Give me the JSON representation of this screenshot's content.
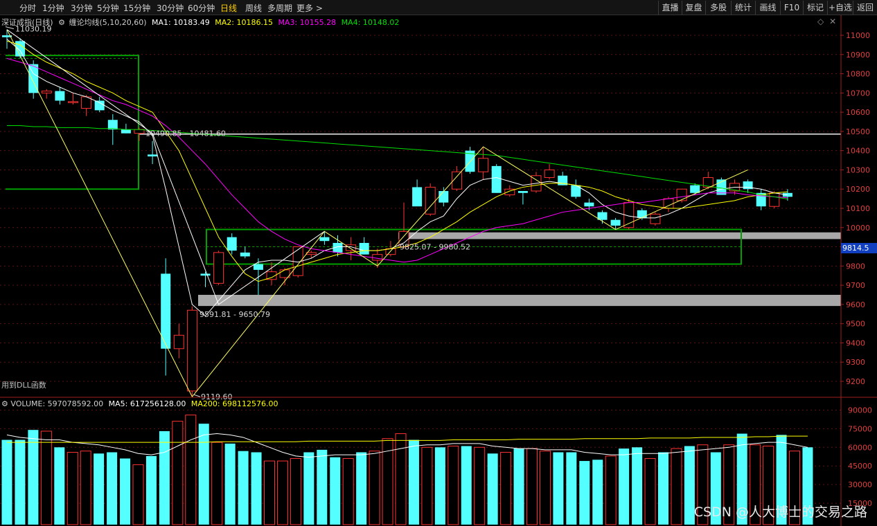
{
  "toolbar": {
    "periods": [
      "分时",
      "1分钟",
      "3分钟",
      "5分钟",
      "15分钟",
      "30分钟",
      "60分钟",
      "日线",
      "周线",
      "多周期",
      "更多 >"
    ],
    "active_period": "日线",
    "right_buttons": [
      "直播",
      "复盘",
      "多股",
      "统计",
      "画线",
      "F10",
      "标记",
      "+自选",
      "返回"
    ]
  },
  "main_panel": {
    "title": "深证成指(日线)",
    "indicator": "缠论均线(5,10,20,60)",
    "ma1": "MA1: 10183.49",
    "ma2": "MA2: 10186.15",
    "ma3": "MA3: 10155.28",
    "ma4": "MA4: 10148.02",
    "price_tag": "9814.5",
    "dll_note": "用到DLL函数",
    "annotations": {
      "high": "11030.19",
      "low": "9119.60",
      "zone1": "10490.85 - 10481.60",
      "zone2": "9825.07 - 9980.52",
      "zone3": "9591.81 - 9650.79"
    }
  },
  "volume_panel": {
    "volume": "VOLUME: 597078592.00",
    "ma5": "MA5: 617256128.00",
    "ma200": "MA200: 698112576.00"
  },
  "watermark": "CSDN @人大博士的交易之路",
  "colors": {
    "up": "#ff3232",
    "down": "#54ffff",
    "ma1": "#ffffff",
    "ma2": "#ffff00",
    "ma3": "#ff00ff",
    "ma4": "#00e000",
    "box": "#00a000",
    "zone": "#a0a0a0"
  },
  "chart_data": [
    {
      "type": "candlestick",
      "title": "深证成指(日线)",
      "y_ticks": [
        11000,
        10900,
        10800,
        10700,
        10600,
        10500,
        10400,
        10300,
        10200,
        10100,
        10000,
        9900,
        9800,
        9700,
        9600,
        9500,
        9400,
        9300,
        9200
      ],
      "ylim": [
        9060,
        11100
      ],
      "candles": [
        {
          "o": 11000,
          "h": 11030,
          "l": 10930,
          "c": 10990
        },
        {
          "o": 10970,
          "h": 10985,
          "l": 10880,
          "c": 10890
        },
        {
          "o": 10850,
          "h": 10870,
          "l": 10670,
          "c": 10700
        },
        {
          "o": 10700,
          "h": 10720,
          "l": 10670,
          "c": 10710
        },
        {
          "o": 10710,
          "h": 10730,
          "l": 10640,
          "c": 10660
        },
        {
          "o": 10650,
          "h": 10700,
          "l": 10640,
          "c": 10655
        },
        {
          "o": 10620,
          "h": 10690,
          "l": 10580,
          "c": 10680
        },
        {
          "o": 10660,
          "h": 10680,
          "l": 10600,
          "c": 10610
        },
        {
          "o": 10560,
          "h": 10590,
          "l": 10430,
          "c": 10510
        },
        {
          "o": 10510,
          "h": 10540,
          "l": 10490,
          "c": 10490
        },
        {
          "o": 10490,
          "h": 10520,
          "l": 10450,
          "c": 10510
        },
        {
          "o": 10380,
          "h": 10450,
          "l": 10330,
          "c": 10370
        },
        {
          "o": 9760,
          "h": 9840,
          "l": 9230,
          "c": 9370
        },
        {
          "o": 9370,
          "h": 9500,
          "l": 9320,
          "c": 9440
        },
        {
          "o": 9150,
          "h": 9590,
          "l": 9120,
          "c": 9570
        },
        {
          "o": 9760,
          "h": 9770,
          "l": 9690,
          "c": 9750
        },
        {
          "o": 9710,
          "h": 9880,
          "l": 9700,
          "c": 9870
        },
        {
          "o": 9950,
          "h": 9970,
          "l": 9860,
          "c": 9880
        },
        {
          "o": 9870,
          "h": 9900,
          "l": 9840,
          "c": 9850
        },
        {
          "o": 9810,
          "h": 9840,
          "l": 9650,
          "c": 9780
        },
        {
          "o": 9730,
          "h": 9820,
          "l": 9700,
          "c": 9770
        },
        {
          "o": 9740,
          "h": 9790,
          "l": 9700,
          "c": 9780
        },
        {
          "o": 9750,
          "h": 9900,
          "l": 9740,
          "c": 9900
        },
        {
          "o": 9860,
          "h": 9880,
          "l": 9840,
          "c": 9870
        },
        {
          "o": 9950,
          "h": 9980,
          "l": 9910,
          "c": 9930
        },
        {
          "o": 9920,
          "h": 9960,
          "l": 9850,
          "c": 9870
        },
        {
          "o": 9880,
          "h": 9950,
          "l": 9830,
          "c": 9910
        },
        {
          "o": 9920,
          "h": 9950,
          "l": 9860,
          "c": 9860
        },
        {
          "o": 9830,
          "h": 9890,
          "l": 9790,
          "c": 9860
        },
        {
          "o": 9860,
          "h": 9930,
          "l": 9850,
          "c": 9890
        },
        {
          "o": 9900,
          "h": 10130,
          "l": 9890,
          "c": 9980
        },
        {
          "o": 10210,
          "h": 10250,
          "l": 10120,
          "c": 10110
        },
        {
          "o": 10070,
          "h": 10230,
          "l": 10060,
          "c": 10210
        },
        {
          "o": 10190,
          "h": 10210,
          "l": 10110,
          "c": 10130
        },
        {
          "o": 10200,
          "h": 10320,
          "l": 10190,
          "c": 10290
        },
        {
          "o": 10400,
          "h": 10420,
          "l": 10280,
          "c": 10290
        },
        {
          "o": 10290,
          "h": 10420,
          "l": 10250,
          "c": 10360
        },
        {
          "o": 10320,
          "h": 10330,
          "l": 10180,
          "c": 10180
        },
        {
          "o": 10170,
          "h": 10220,
          "l": 10160,
          "c": 10200
        },
        {
          "o": 10190,
          "h": 10190,
          "l": 10120,
          "c": 10180
        },
        {
          "o": 10190,
          "h": 10290,
          "l": 10180,
          "c": 10270
        },
        {
          "o": 10260,
          "h": 10330,
          "l": 10250,
          "c": 10300
        },
        {
          "o": 10270,
          "h": 10290,
          "l": 10220,
          "c": 10220
        },
        {
          "o": 10220,
          "h": 10250,
          "l": 10150,
          "c": 10160
        },
        {
          "o": 10130,
          "h": 10150,
          "l": 10090,
          "c": 10110
        },
        {
          "o": 10080,
          "h": 10090,
          "l": 10020,
          "c": 10040
        },
        {
          "o": 10040,
          "h": 10050,
          "l": 9990,
          "c": 10010
        },
        {
          "o": 10000,
          "h": 10150,
          "l": 9990,
          "c": 10130
        },
        {
          "o": 10090,
          "h": 10100,
          "l": 10040,
          "c": 10050
        },
        {
          "o": 10020,
          "h": 10080,
          "l": 10010,
          "c": 10070
        },
        {
          "o": 10100,
          "h": 10160,
          "l": 10080,
          "c": 10150
        },
        {
          "o": 10140,
          "h": 10200,
          "l": 10130,
          "c": 10200
        },
        {
          "o": 10220,
          "h": 10230,
          "l": 10170,
          "c": 10180
        },
        {
          "o": 10210,
          "h": 10290,
          "l": 10200,
          "c": 10260
        },
        {
          "o": 10250,
          "h": 10260,
          "l": 10170,
          "c": 10170
        },
        {
          "o": 10190,
          "h": 10250,
          "l": 10170,
          "c": 10230
        },
        {
          "o": 10240,
          "h": 10250,
          "l": 10180,
          "c": 10200
        },
        {
          "o": 10180,
          "h": 10200,
          "l": 10090,
          "c": 10110
        },
        {
          "o": 10110,
          "h": 10190,
          "l": 10100,
          "c": 10180
        },
        {
          "o": 10180,
          "h": 10200,
          "l": 10140,
          "c": 10160
        }
      ],
      "ma1": [
        10980,
        10920,
        10800,
        10760,
        10730,
        10700,
        10680,
        10650,
        10610,
        10580,
        10550,
        10480,
        10200,
        9900,
        9600,
        9540,
        9620,
        9700,
        9780,
        9820,
        9830,
        9830,
        9820,
        9840,
        9880,
        9900,
        9900,
        9880,
        9880,
        9890,
        9920,
        9980,
        10030,
        10060,
        10150,
        10220,
        10250,
        10260,
        10240,
        10220,
        10230,
        10240,
        10230,
        10220,
        10180,
        10120,
        10080,
        10060,
        10050,
        10050,
        10070,
        10100,
        10140,
        10180,
        10200,
        10210,
        10210,
        10200,
        10180,
        10170
      ],
      "ma2": [
        10970,
        10950,
        10900,
        10860,
        10830,
        10800,
        10760,
        10730,
        10700,
        10660,
        10630,
        10600,
        10500,
        10400,
        10250,
        10100,
        9950,
        9850,
        9760,
        9720,
        9740,
        9780,
        9800,
        9820,
        9840,
        9860,
        9870,
        9880,
        9880,
        9890,
        9900,
        9920,
        9950,
        9990,
        10030,
        10080,
        10120,
        10160,
        10190,
        10210,
        10220,
        10230,
        10230,
        10220,
        10210,
        10190,
        10160,
        10140,
        10120,
        10110,
        10100,
        10100,
        10110,
        10120,
        10130,
        10140,
        10160,
        10170,
        10180,
        10186
      ],
      "ma3": [
        10880,
        10860,
        10840,
        10810,
        10780,
        10750,
        10720,
        10690,
        10660,
        10640,
        10610,
        10580,
        10530,
        10470,
        10400,
        10330,
        10250,
        10170,
        10100,
        10030,
        9980,
        9940,
        9910,
        9890,
        9880,
        9870,
        9860,
        9850,
        9840,
        9830,
        9820,
        9830,
        9860,
        9890,
        9920,
        9950,
        9980,
        10000,
        10010,
        10020,
        10040,
        10060,
        10080,
        10090,
        10100,
        10110,
        10120,
        10130,
        10130,
        10140,
        10150,
        10160,
        10170,
        10180,
        10180,
        10180,
        10170,
        10165,
        10160,
        10155
      ],
      "ma4": [
        10530,
        10530,
        10525,
        10525,
        10520,
        10520,
        10520,
        10515,
        10515,
        10510,
        10510,
        10505,
        10500,
        10495,
        10490,
        10485,
        10480,
        10475,
        10470,
        10465,
        10460,
        10455,
        10450,
        10445,
        10440,
        10435,
        10430,
        10425,
        10420,
        10415,
        10410,
        10405,
        10400,
        10395,
        10390,
        10385,
        10380,
        10375,
        10365,
        10355,
        10345,
        10335,
        10325,
        10315,
        10305,
        10295,
        10285,
        10275,
        10265,
        10255,
        10245,
        10235,
        10225,
        10215,
        10205,
        10195,
        10185,
        10170,
        10160,
        10148
      ]
    },
    {
      "type": "bar",
      "title": "VOLUME",
      "y_ticks": [
        90000,
        75000,
        60000,
        45000,
        30000,
        15000
      ],
      "ylim": [
        0,
        95000
      ],
      "values": [
        66000,
        66000,
        74000,
        73000,
        60000,
        56000,
        57000,
        55000,
        56000,
        51000,
        46000,
        53000,
        73000,
        81000,
        86000,
        79000,
        64000,
        63000,
        57000,
        56000,
        49000,
        49000,
        51000,
        56000,
        58000,
        52000,
        51000,
        56000,
        57000,
        67000,
        71000,
        66000,
        60000,
        60000,
        61000,
        61000,
        60000,
        55000,
        56000,
        59000,
        59000,
        57000,
        56000,
        56000,
        49000,
        50000,
        53000,
        59000,
        60000,
        51000,
        56000,
        59000,
        61000,
        62000,
        56000,
        62000,
        71000,
        62000,
        61000,
        70000,
        57000,
        60000
      ],
      "up": [
        false,
        false,
        false,
        true,
        false,
        true,
        true,
        false,
        false,
        false,
        true,
        false,
        false,
        true,
        true,
        false,
        true,
        false,
        false,
        false,
        true,
        true,
        true,
        false,
        false,
        false,
        true,
        false,
        true,
        true,
        true,
        false,
        true,
        false,
        true,
        false,
        true,
        false,
        true,
        false,
        true,
        true,
        false,
        false,
        false,
        false,
        true,
        false,
        false,
        true,
        false,
        true,
        false,
        true,
        false,
        true,
        false,
        true,
        true,
        false,
        true,
        false
      ],
      "ma5": [
        70000,
        68000,
        67000,
        66000,
        66000,
        64000,
        63000,
        62000,
        60000,
        58000,
        55000,
        54000,
        56000,
        61000,
        66000,
        70000,
        71000,
        70000,
        68000,
        64000,
        60000,
        56000,
        53000,
        52000,
        53000,
        54000,
        54000,
        54000,
        55000,
        57000,
        59000,
        61000,
        62000,
        62000,
        63000,
        63000,
        63000,
        61000,
        60000,
        59000,
        59000,
        58000,
        58000,
        58000,
        56000,
        55000,
        54000,
        54000,
        55000,
        55000,
        55000,
        56000,
        57000,
        58000,
        59000,
        60000,
        62000,
        63000,
        64000,
        64000,
        62000,
        60000
      ],
      "ma200": [
        64000,
        64000,
        64000,
        64000,
        64000,
        64000,
        64000,
        64000,
        64000,
        64000,
        64000,
        64000,
        64000,
        64000,
        64000,
        64000,
        64500,
        64500,
        64500,
        64500,
        64500,
        64500,
        64500,
        65000,
        65000,
        65000,
        65000,
        65000,
        65000,
        65500,
        65500,
        65500,
        65500,
        65500,
        66000,
        66000,
        66000,
        66000,
        66000,
        66500,
        66500,
        66500,
        66500,
        66500,
        67000,
        67000,
        67000,
        67000,
        67000,
        67500,
        67500,
        67500,
        67500,
        68000,
        68000,
        68000,
        68000,
        68500,
        68500,
        69000,
        69000,
        69000
      ]
    }
  ]
}
